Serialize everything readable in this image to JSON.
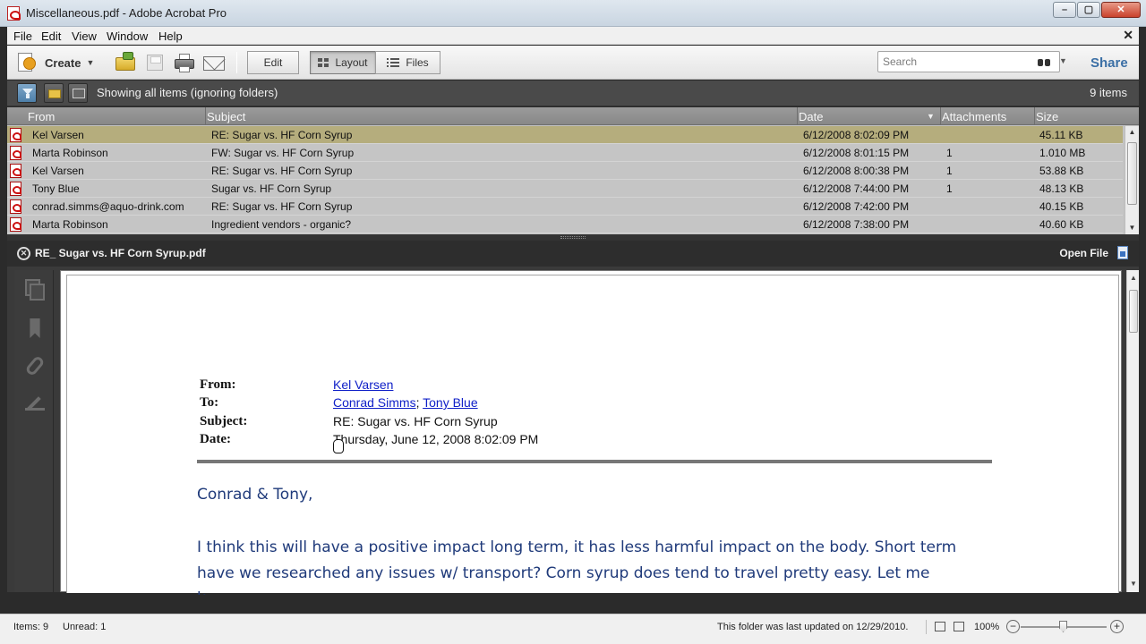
{
  "window": {
    "title": "Miscellaneous.pdf - Adobe Acrobat Pro"
  },
  "menu": [
    {
      "label": "File",
      "name": "menu-file"
    },
    {
      "label": "Edit",
      "name": "menu-edit"
    },
    {
      "label": "View",
      "name": "menu-view"
    },
    {
      "label": "Window",
      "name": "menu-window"
    },
    {
      "label": "Help",
      "name": "menu-help"
    }
  ],
  "toolbar": {
    "create_label": "Create",
    "edit_label": "Edit",
    "layout_label": "Layout",
    "files_label": "Files",
    "search_placeholder": "Search",
    "share_label": "Share"
  },
  "filterbar": {
    "status_text": "Showing all items (ignoring folders)",
    "items_count": "9 items"
  },
  "list": {
    "columns": [
      "From",
      "Subject",
      "Date",
      "Attachments",
      "Size"
    ],
    "rows": [
      {
        "from": "Kel Varsen",
        "subject": "RE: Sugar vs. HF Corn Syrup",
        "date": "6/12/2008 8:02:09 PM",
        "attachments": "",
        "size": "45.11 KB",
        "selected": true
      },
      {
        "from": "Marta Robinson",
        "subject": "FW: Sugar vs. HF Corn Syrup",
        "date": "6/12/2008 8:01:15 PM",
        "attachments": "1",
        "size": "1.010 MB",
        "selected": false
      },
      {
        "from": "Kel Varsen",
        "subject": "RE: Sugar vs. HF Corn Syrup",
        "date": "6/12/2008 8:00:38 PM",
        "attachments": "1",
        "size": "53.88 KB",
        "selected": false
      },
      {
        "from": "Tony Blue",
        "subject": "Sugar vs. HF Corn Syrup",
        "date": "6/12/2008 7:44:00 PM",
        "attachments": "1",
        "size": "48.13 KB",
        "selected": false
      },
      {
        "from": "conrad.simms@aquo-drink.com",
        "subject": "RE: Sugar vs. HF Corn Syrup",
        "date": "6/12/2008 7:42:00 PM",
        "attachments": "",
        "size": "40.15 KB",
        "selected": false
      },
      {
        "from": "Marta Robinson",
        "subject": "Ingredient vendors - organic?",
        "date": "6/12/2008 7:38:00 PM",
        "attachments": "",
        "size": "40.60 KB",
        "selected": false
      }
    ]
  },
  "preview": {
    "file_title": "RE_ Sugar vs. HF Corn Syrup.pdf",
    "open_file_label": "Open File",
    "email": {
      "from_label": "From:",
      "to_label": "To:",
      "subject_label": "Subject:",
      "date_label": "Date:",
      "from": "Kel Varsen",
      "to_1": "Conrad Simms",
      "to_sep": ";",
      "to_2": "Tony Blue",
      "subject": "RE: Sugar vs. HF Corn Syrup",
      "date": "Thursday, June 12, 2008 8:02:09 PM",
      "greeting": "Conrad & Tony,",
      "body_line_1": "I think this will have a positive impact long term, it has less harmful impact on the body. Short term",
      "body_line_2": "have we researched any issues w/ transport? Corn syrup does tend to travel pretty easy. Let me",
      "body_line_3": "k"
    }
  },
  "statusbar": {
    "items": "Items: 9",
    "unread": "Unread: 1",
    "updated": "This folder was last updated on 12/29/2010.",
    "zoom": "100%",
    "zoom_level_percent": 50
  }
}
